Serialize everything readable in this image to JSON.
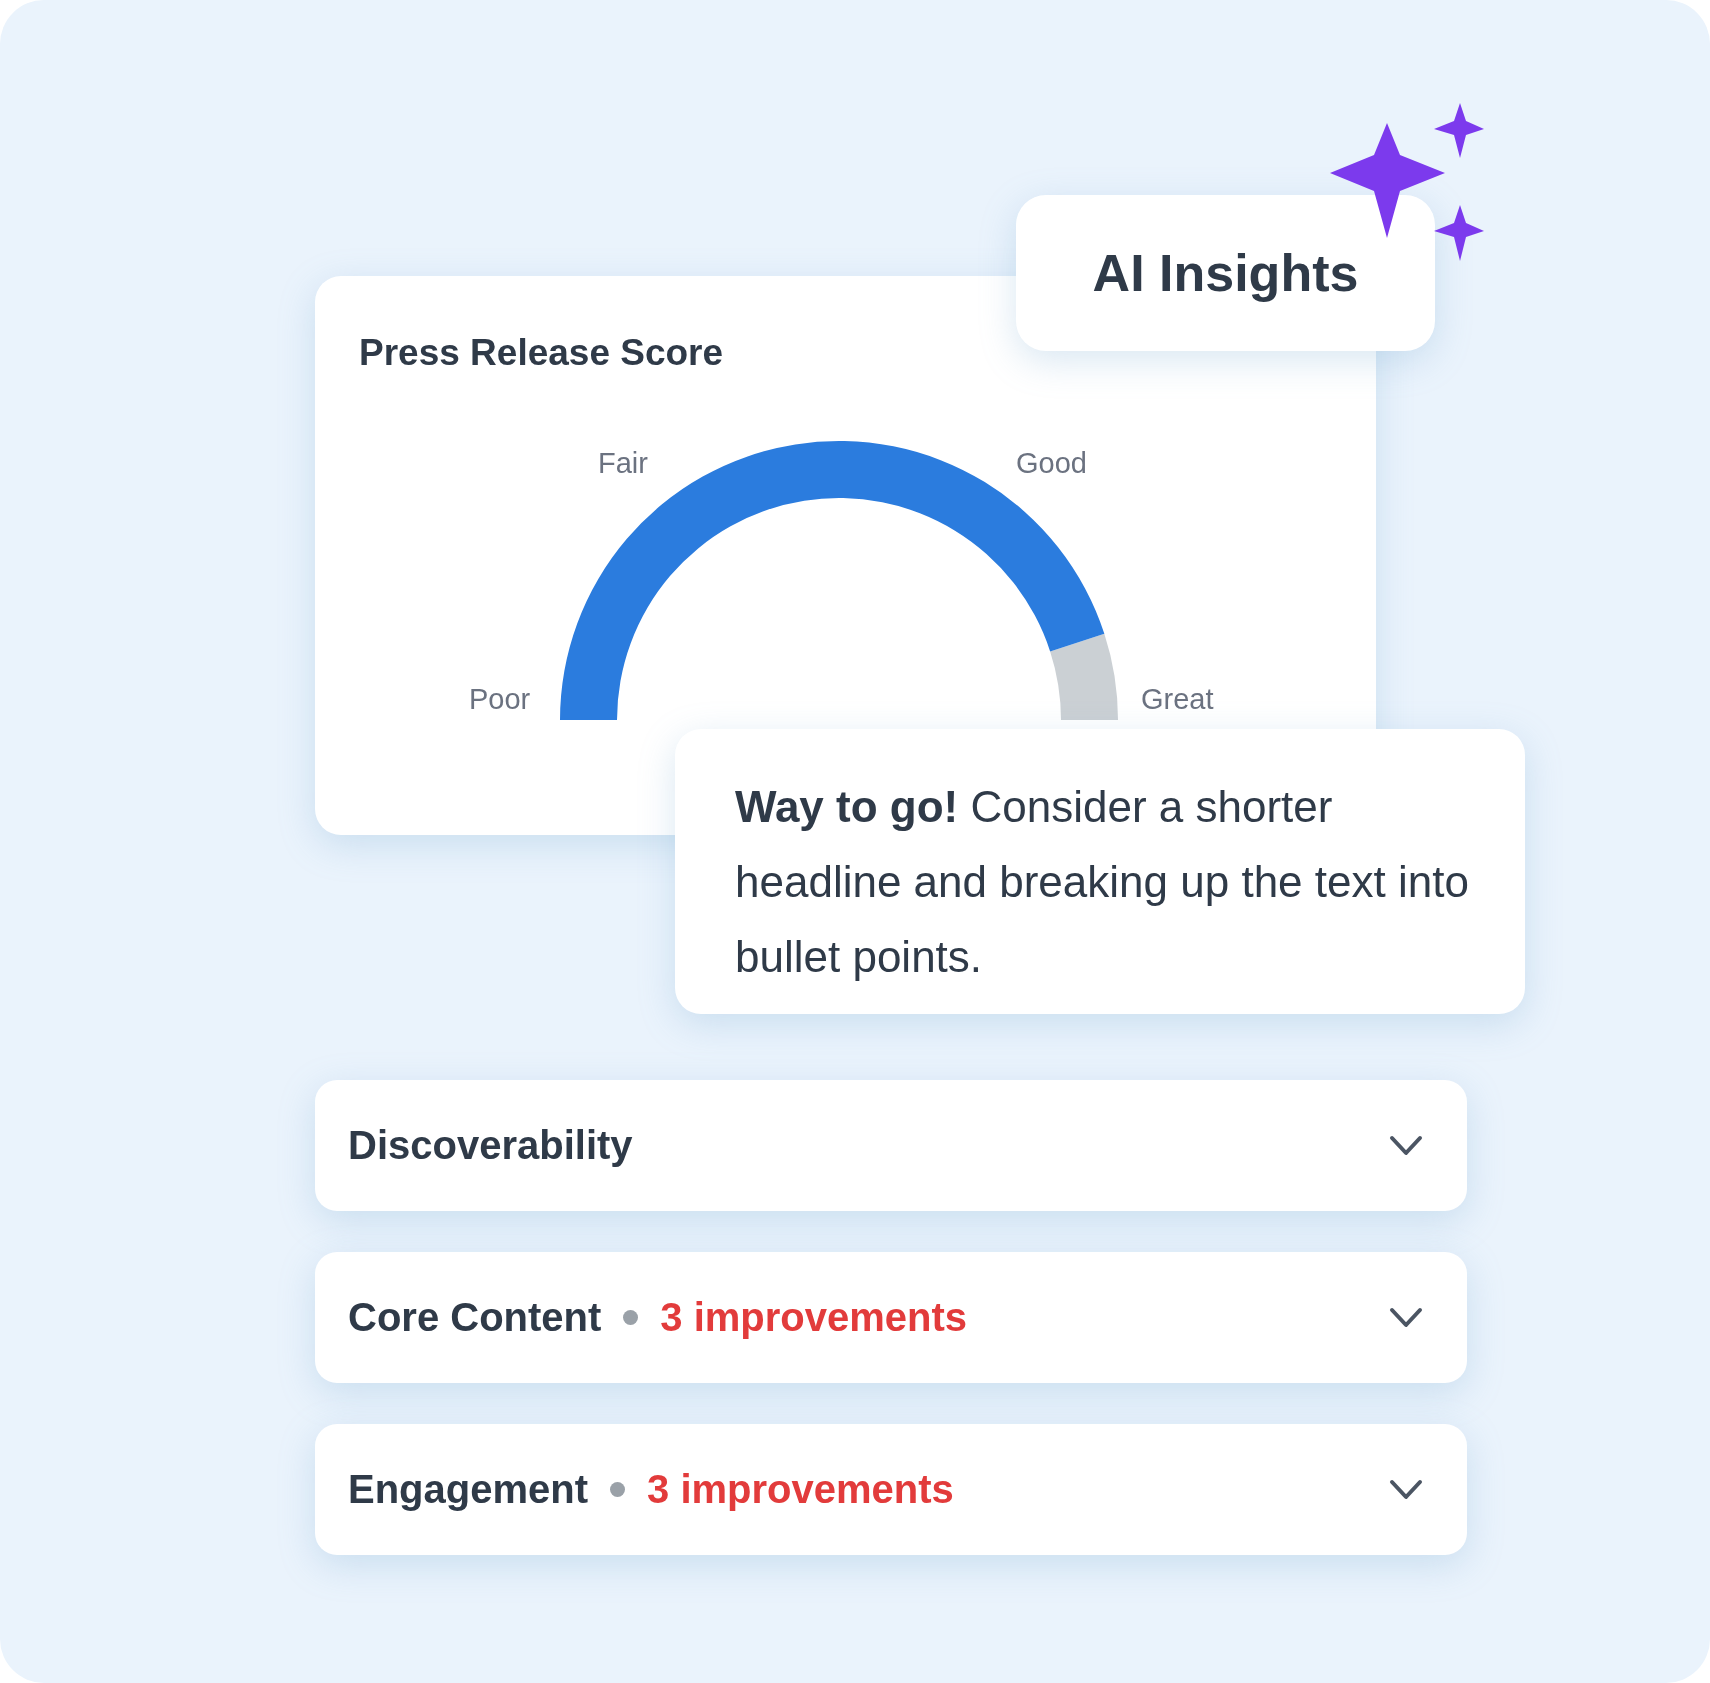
{
  "score_card": {
    "title": "Press Release Score",
    "gauge": {
      "labels": {
        "poor": "Poor",
        "fair": "Fair",
        "good": "Good",
        "great": "Great"
      }
    }
  },
  "badge": {
    "title": "AI Insights"
  },
  "tip": {
    "text": "**Way to go!** Consider a shorter headline and breaking up the text into bullet points."
  },
  "sections": [
    {
      "title": "Discoverability"
    },
    {
      "title": "Core Content",
      "note": "3 improvements"
    },
    {
      "title": "Engagement",
      "note": "3 improvements"
    }
  ]
}
